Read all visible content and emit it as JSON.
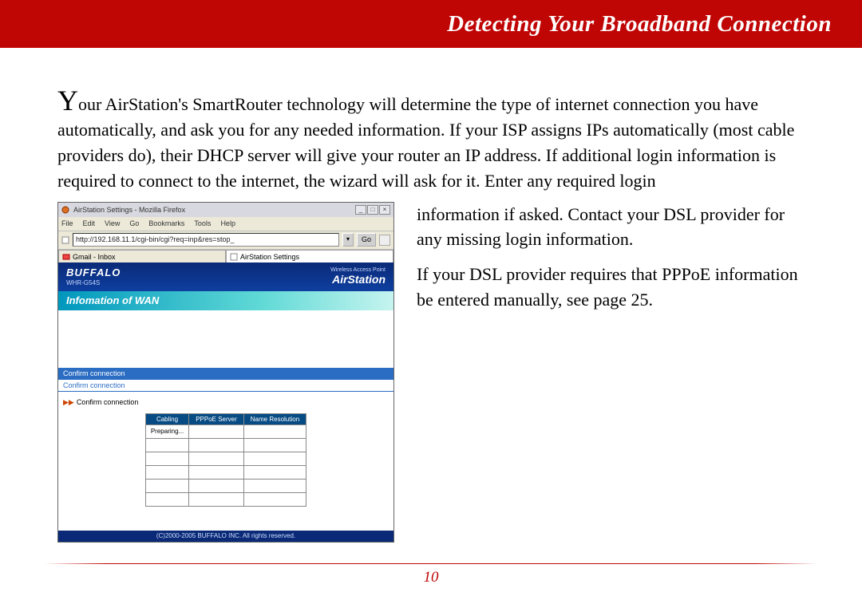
{
  "header": {
    "title": "Detecting Your Broadband Connection"
  },
  "paragraphs": {
    "p1_dropcap": "Y",
    "p1_rest": "our AirStation's SmartRouter technology will determine the type of internet connection you have automatically, and ask you for any needed information.  If your ISP assigns IPs automatically (most cable providers do), their DHCP server will give your router an IP address.  If additional login information is required to connect to the internet, the wizard will ask for it.  Enter any required login",
    "p2": "information if asked.  Contact your DSL provider for any missing login information.",
    "p3": "If your DSL provider requires that PPPoE information be entered manually, see page 25."
  },
  "screenshot": {
    "window_title": "AirStation Settings - Mozilla Firefox",
    "menubar": [
      "File",
      "Edit",
      "View",
      "Go",
      "Bookmarks",
      "Tools",
      "Help"
    ],
    "url": "http://192.168.11.1/cgi-bin/cgi?req=inp&res=stop_",
    "go_label": "Go",
    "tabs": [
      {
        "label": "Gmail - Inbox",
        "active": false
      },
      {
        "label": "AirStation Settings",
        "active": true
      }
    ],
    "brand": "BUFFALO",
    "model": "WHR-G54S",
    "wap_label": "Wireless Access Point",
    "product": "AirStation",
    "section_title": "Infomation of WAN",
    "confirm_header": "Confirm connection",
    "confirm_sub": "Confirm connection",
    "confirm_line": "Confirm connection",
    "table_headers": [
      "Cabling",
      "PPPoE Server",
      "Name Resolution"
    ],
    "table_row1": [
      "Preparing...",
      "",
      ""
    ],
    "copyright": "(C)2000-2005 BUFFALO INC. All rights reserved."
  },
  "footer": {
    "page_number": "10"
  }
}
